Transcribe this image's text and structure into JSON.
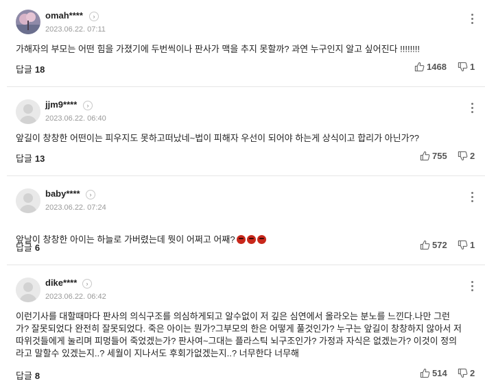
{
  "comments": [
    {
      "nickname": "omah****",
      "date": "2023.06.22. 07:11",
      "text": "가해자의 부모는 어떤 힘을 가졌기에 두번씩이나 판사가 맥을 추지 못할까? 과연 누구인지 알고 싶어진다 !!!!!!!!",
      "reply_label": "답글",
      "reply_count": "18",
      "likes": "1468",
      "dislikes": "1",
      "avatar": "photo"
    },
    {
      "nickname": "jjm9****",
      "date": "2023.06.22. 06:40",
      "text": "앞길이 창창한 어떤이는 피우지도 못하고떠났네~법이 피해자 우선이 되어야 하는게 상식이고 합리가 아닌가??",
      "reply_label": "답글",
      "reply_count": "13",
      "likes": "755",
      "dislikes": "2",
      "avatar": "default"
    },
    {
      "nickname": "baby****",
      "date": "2023.06.22. 07:24",
      "text": "앞날이 창창한 아이는 하늘로 가버렸는데 뭣이 어쩌고 어째?",
      "emoji": "angry-face-emoji",
      "reply_label": "답글",
      "reply_count": "6",
      "likes": "572",
      "dislikes": "1",
      "avatar": "default"
    },
    {
      "nickname": "dike****",
      "date": "2023.06.22. 06:42",
      "text": "이런기사를 대할때마다 판사의 의식구조를 의심하게되고 알수없이 저 깊은 심연에서 올라오는 분노를 느낀다.나만 그런가? 잘못되었다 완전히 잘못되었다. 죽은 아이는 뭔가?그부모의 한은 어떻게 풀것인가? 누구는 앞길이 창창하지 않아서 저따위것들에게 눌리며 피멍들어 죽었겠는가? 판사여~그대는 플라스틱 뇌구조인가? 가정과 자식은 없겠는가? 이것이 정의라고 말할수 있겠는지..? 세월이 지나서도 후회가없겠는지..? 너무한다 너무해",
      "reply_label": "답글",
      "reply_count": "8",
      "likes": "514",
      "dislikes": "2",
      "avatar": "default"
    }
  ]
}
